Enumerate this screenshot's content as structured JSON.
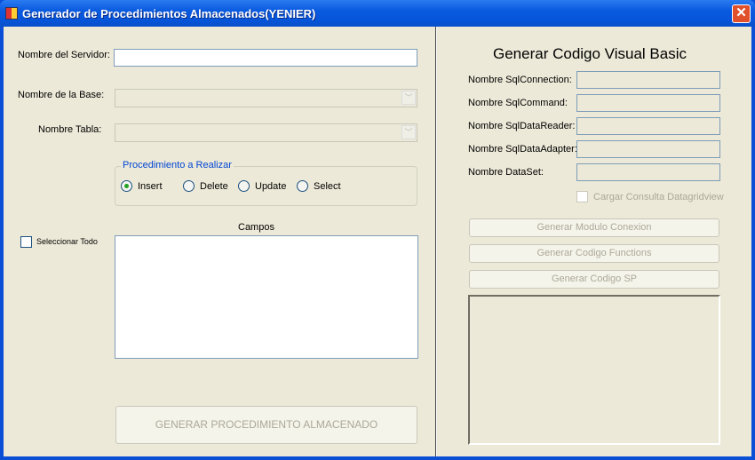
{
  "window": {
    "title": "Generador de Procedimientos Almacenados(YENIER)",
    "close_label": "✕"
  },
  "left": {
    "server_label": "Nombre del Servidor:",
    "server_value": "",
    "database_label": "Nombre de la Base:",
    "database_value": "",
    "table_label": "Nombre Tabla:",
    "table_value": "",
    "procedure_group": {
      "legend": "Procedimiento a Realizar",
      "options": [
        "Insert",
        "Delete",
        "Update",
        "Select"
      ],
      "selected": "Insert"
    },
    "select_all_label": "Seleccionar Todo",
    "select_all_checked": false,
    "fields_label": "Campos",
    "fields_items": [],
    "generate_button": "GENERAR PROCEDIMIENTO ALMACENADO"
  },
  "right": {
    "heading": "Generar Codigo Visual Basic",
    "fields": [
      {
        "label": "Nombre SqlConnection:",
        "value": ""
      },
      {
        "label": "Nombre SqlCommand:",
        "value": ""
      },
      {
        "label": "Nombre SqlDataReader:",
        "value": ""
      },
      {
        "label": "Nombre SqlDataAdapter:",
        "value": ""
      },
      {
        "label": "Nombre DataSet:",
        "value": ""
      }
    ],
    "load_grid_label": "Cargar Consulta Datagridview",
    "load_grid_checked": false,
    "buttons": [
      "Generar Modulo Conexion",
      "Generar Codigo Functions",
      "Generar Codigo SP"
    ],
    "output_text": ""
  }
}
